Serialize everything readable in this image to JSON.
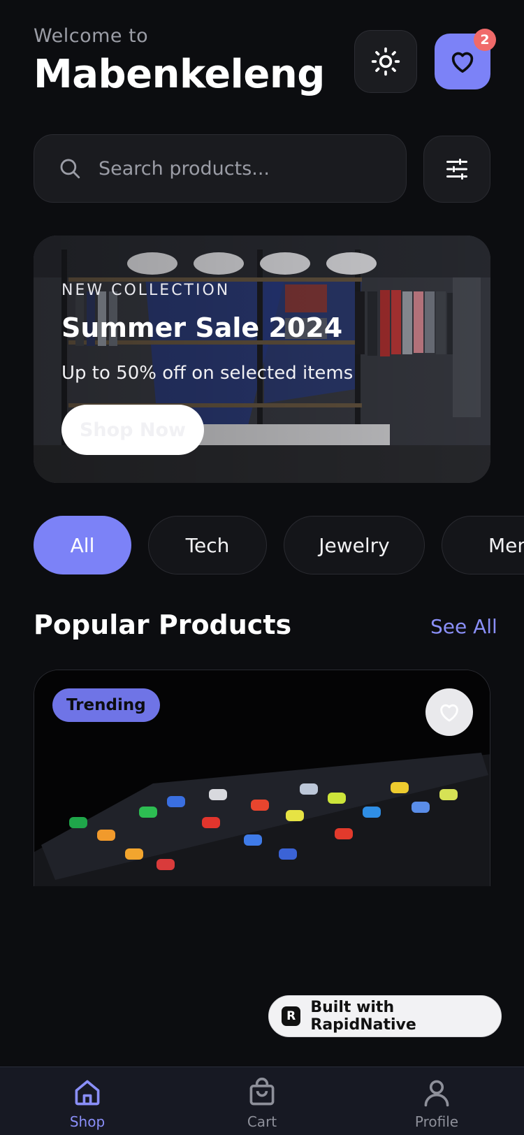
{
  "header": {
    "welcome": "Welcome to",
    "brand": "Mabenkeleng",
    "favorites_count": "2"
  },
  "search": {
    "placeholder": "Search products..."
  },
  "banner": {
    "eyebrow": "NEW COLLECTION",
    "title": "Summer Sale 2024",
    "subtitle": "Up to 50% off on selected items",
    "cta": "Shop Now"
  },
  "categories": [
    {
      "label": "All",
      "active": true
    },
    {
      "label": "Tech",
      "active": false
    },
    {
      "label": "Jewelry",
      "active": false
    },
    {
      "label": "Men",
      "active": false
    }
  ],
  "popular": {
    "title": "Popular Products",
    "see_all": "See All",
    "card": {
      "badge": "Trending"
    }
  },
  "built_with": "Built with RapidNative",
  "tabbar": [
    {
      "label": "Shop",
      "icon": "home-icon",
      "active": true
    },
    {
      "label": "Cart",
      "icon": "shopping-bag-icon",
      "active": false
    },
    {
      "label": "Profile",
      "icon": "user-icon",
      "active": false
    }
  ],
  "colors": {
    "accent": "#7c82f7",
    "badge": "#f06a6a",
    "background": "#0c0d10"
  }
}
